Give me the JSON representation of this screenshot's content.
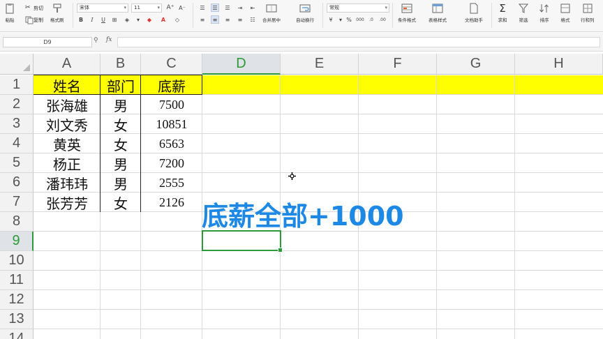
{
  "ribbon": {
    "paste_label": "粘贴",
    "cut_label": "剪切",
    "copy_label": "复制",
    "format_painter_label": "格式刷",
    "font_name": "宋体",
    "font_size": "11",
    "number_format": "常规",
    "merge_center_label": "合并居中",
    "wrap_label": "自动换行",
    "cond_format_label": "条件格式",
    "table_style_label": "表格样式",
    "doc_helper_label": "文档助手",
    "sum_label": "求和",
    "filter_label": "筛选",
    "sort_label": "排序",
    "format_label": "格式",
    "rowcol_label": "行和列"
  },
  "formula_bar": {
    "cell_ref": "D9",
    "fx_label": "fx",
    "content": ""
  },
  "grid": {
    "columns": [
      "A",
      "B",
      "C",
      "D",
      "E",
      "F",
      "G",
      "H"
    ],
    "active_column": "D",
    "rows": [
      "1",
      "2",
      "3",
      "4",
      "5",
      "6",
      "7",
      "8",
      "9",
      "10",
      "11",
      "12",
      "13",
      "14"
    ],
    "active_row": "9",
    "headers": [
      "姓名",
      "部门",
      "底薪"
    ],
    "data": [
      [
        "张海雄",
        "男",
        "7500"
      ],
      [
        "刘文秀",
        "女",
        "10851"
      ],
      [
        "黄英",
        "女",
        "6563"
      ],
      [
        "杨正",
        "男",
        "7200"
      ],
      [
        "潘玮玮",
        "男",
        "2555"
      ],
      [
        "张芳芳",
        "女",
        "2126"
      ]
    ],
    "highlight_color": "#ffff00",
    "selection_color": "#2c9a36"
  },
  "overlay": {
    "caption": "底薪全部+1000",
    "color": "#1e88e5"
  }
}
